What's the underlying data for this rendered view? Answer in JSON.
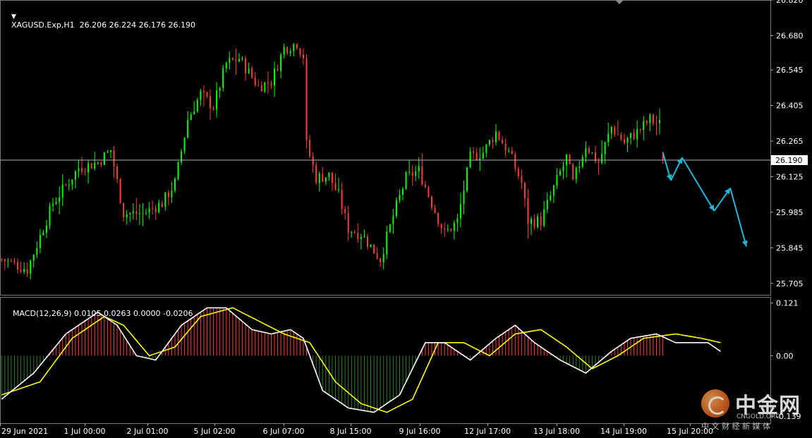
{
  "header": {
    "symbol_line": "XAGUSD.Exp,H1  26.206 26.224 26.176 26.190",
    "macd_line": "MACD(12,26,9) 0.0105 0.0263 0.0000 -0.0206"
  },
  "watermark": {
    "logo_text": "中金网",
    "logo_url_text": "CNGOLD.ORG",
    "logo_slogan": "中 文 财 经 新 媒 体"
  },
  "colors": {
    "background": "#000000",
    "bull_candle": "#00ff00",
    "bear_candle": "#ff3b3b",
    "macd_line": "#ffffff",
    "signal_line": "#ffff00",
    "hist_positive": "#ff3b3b",
    "hist_negative": "#2e7d2e",
    "arrow": "#1fb8d6",
    "current_price_line": "#aab4c0"
  },
  "chart_data": [
    {
      "type": "candlestick",
      "title": "XAGUSD.Exp,H1",
      "timeframe": "H1",
      "last_bar": {
        "open": 26.206,
        "high": 26.224,
        "low": 26.176,
        "close": 26.19
      },
      "current_price": 26.19,
      "current_price_label": "26.190",
      "ylim": [
        25.66,
        26.82
      ],
      "y_ticks": [
        {
          "value": 26.82,
          "label": "26.820"
        },
        {
          "value": 26.68,
          "label": "26.680"
        },
        {
          "value": 26.545,
          "label": "26.545"
        },
        {
          "value": 26.405,
          "label": "26.405"
        },
        {
          "value": 26.265,
          "label": "26.265"
        },
        {
          "value": 26.125,
          "label": "26.125"
        },
        {
          "value": 25.985,
          "label": "25.985"
        },
        {
          "value": 25.845,
          "label": "25.845"
        },
        {
          "value": 25.705,
          "label": "25.705"
        }
      ],
      "x_ticks": [
        "29 Jun 2021",
        "1 Jul 00:00",
        "2 Jul 01:00",
        "5 Jul 02:00",
        "6 Jul 07:00",
        "8 Jul 15:00",
        "9 Jul 16:00",
        "12 Jul 17:00",
        "13 Jul 18:00",
        "14 Jul 19:00",
        "15 Jul 20:00"
      ],
      "close_path": [
        [
          0,
          25.8
        ],
        [
          8,
          25.76
        ],
        [
          16,
          26.02
        ],
        [
          24,
          26.16
        ],
        [
          30,
          26.18
        ],
        [
          34,
          26.23
        ],
        [
          38,
          25.98
        ],
        [
          44,
          25.98
        ],
        [
          50,
          26.02
        ],
        [
          54,
          26.1
        ],
        [
          58,
          26.35
        ],
        [
          62,
          26.45
        ],
        [
          66,
          26.4
        ],
        [
          70,
          26.57
        ],
        [
          74,
          26.59
        ],
        [
          80,
          26.48
        ],
        [
          84,
          26.5
        ],
        [
          88,
          26.63
        ],
        [
          92,
          26.65
        ],
        [
          94,
          26.6
        ],
        [
          95,
          26.25
        ],
        [
          98,
          26.12
        ],
        [
          102,
          26.13
        ],
        [
          105,
          26.05
        ],
        [
          108,
          25.92
        ],
        [
          112,
          25.9
        ],
        [
          118,
          25.8
        ],
        [
          122,
          25.97
        ],
        [
          126,
          26.12
        ],
        [
          130,
          26.15
        ],
        [
          134,
          26.02
        ],
        [
          138,
          25.9
        ],
        [
          142,
          25.95
        ],
        [
          146,
          26.2
        ],
        [
          150,
          26.22
        ],
        [
          154,
          26.3
        ],
        [
          158,
          26.22
        ],
        [
          162,
          26.1
        ],
        [
          164,
          25.95
        ],
        [
          168,
          25.95
        ],
        [
          172,
          26.08
        ],
        [
          176,
          26.2
        ],
        [
          178,
          26.1
        ],
        [
          182,
          26.25
        ],
        [
          186,
          26.18
        ],
        [
          190,
          26.32
        ],
        [
          194,
          26.26
        ],
        [
          198,
          26.3
        ],
        [
          202,
          26.35
        ],
        [
          205,
          26.33
        ],
        [
          206,
          26.22
        ]
      ],
      "forecast_arrow_path": [
        [
          206,
          26.22
        ],
        [
          208.5,
          26.11
        ],
        [
          212,
          26.2
        ],
        [
          222,
          25.99
        ],
        [
          227,
          26.08
        ],
        [
          232,
          25.85
        ]
      ]
    },
    {
      "type": "line",
      "title": "MACD(12,26,9)",
      "values_label": "0.0105 0.0263 0.0000 -0.0206",
      "ylim": [
        -0.155,
        0.135
      ],
      "y_ticks": [
        {
          "value": 0.121,
          "label": "0.121"
        },
        {
          "value": 0.0,
          "label": "0.00"
        },
        {
          "value": -0.139,
          "label": "-0.139"
        }
      ],
      "macd_path": [
        [
          0,
          -0.1
        ],
        [
          10,
          -0.04
        ],
        [
          20,
          0.05
        ],
        [
          30,
          0.1
        ],
        [
          36,
          0.07
        ],
        [
          42,
          0.0
        ],
        [
          48,
          -0.01
        ],
        [
          56,
          0.07
        ],
        [
          64,
          0.11
        ],
        [
          70,
          0.11
        ],
        [
          78,
          0.06
        ],
        [
          84,
          0.05
        ],
        [
          90,
          0.06
        ],
        [
          94,
          0.04
        ],
        [
          100,
          -0.08
        ],
        [
          108,
          -0.12
        ],
        [
          116,
          -0.13
        ],
        [
          124,
          -0.09
        ],
        [
          132,
          0.03
        ],
        [
          138,
          0.03
        ],
        [
          146,
          -0.01
        ],
        [
          154,
          0.04
        ],
        [
          160,
          0.07
        ],
        [
          166,
          0.03
        ],
        [
          174,
          -0.01
        ],
        [
          182,
          -0.04
        ],
        [
          190,
          0.01
        ],
        [
          196,
          0.04
        ],
        [
          204,
          0.05
        ],
        [
          210,
          0.03
        ],
        [
          216,
          0.03
        ],
        [
          220,
          0.03
        ],
        [
          224,
          0.01
        ]
      ],
      "signal_path": [
        [
          0,
          -0.09
        ],
        [
          12,
          -0.06
        ],
        [
          22,
          0.04
        ],
        [
          32,
          0.09
        ],
        [
          38,
          0.07
        ],
        [
          46,
          0.0
        ],
        [
          54,
          0.02
        ],
        [
          62,
          0.09
        ],
        [
          72,
          0.11
        ],
        [
          80,
          0.08
        ],
        [
          88,
          0.05
        ],
        [
          96,
          0.03
        ],
        [
          104,
          -0.06
        ],
        [
          112,
          -0.11
        ],
        [
          120,
          -0.13
        ],
        [
          128,
          -0.1
        ],
        [
          136,
          0.03
        ],
        [
          144,
          0.03
        ],
        [
          152,
          0.0
        ],
        [
          160,
          0.05
        ],
        [
          168,
          0.06
        ],
        [
          176,
          0.02
        ],
        [
          184,
          -0.03
        ],
        [
          192,
          0.0
        ],
        [
          200,
          0.04
        ],
        [
          210,
          0.05
        ],
        [
          218,
          0.04
        ],
        [
          224,
          0.03
        ]
      ]
    }
  ]
}
